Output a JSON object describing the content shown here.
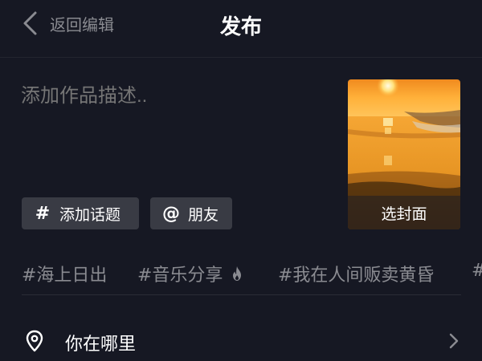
{
  "header": {
    "back_label": "返回编辑",
    "title": "发布"
  },
  "description": {
    "placeholder": "添加作品描述.."
  },
  "cover": {
    "label": "选封面"
  },
  "chips": {
    "topic_icon": "#",
    "topic_label": "添加话题",
    "friend_icon": "@",
    "friend_label": "朋友"
  },
  "hashtags": [
    {
      "text": "#海上日出"
    },
    {
      "text": "#音乐分享",
      "icon": "flame-icon"
    },
    {
      "text": "#我在人间贩卖黄昏"
    },
    {
      "text": "#"
    }
  ],
  "location": {
    "label": "你在哪里",
    "icon": "location-pin-icon"
  },
  "colors": {
    "background": "#161823",
    "chip_background": "#393b44",
    "muted_text": "#8a8b91",
    "placeholder_text": "#7c7d83"
  }
}
